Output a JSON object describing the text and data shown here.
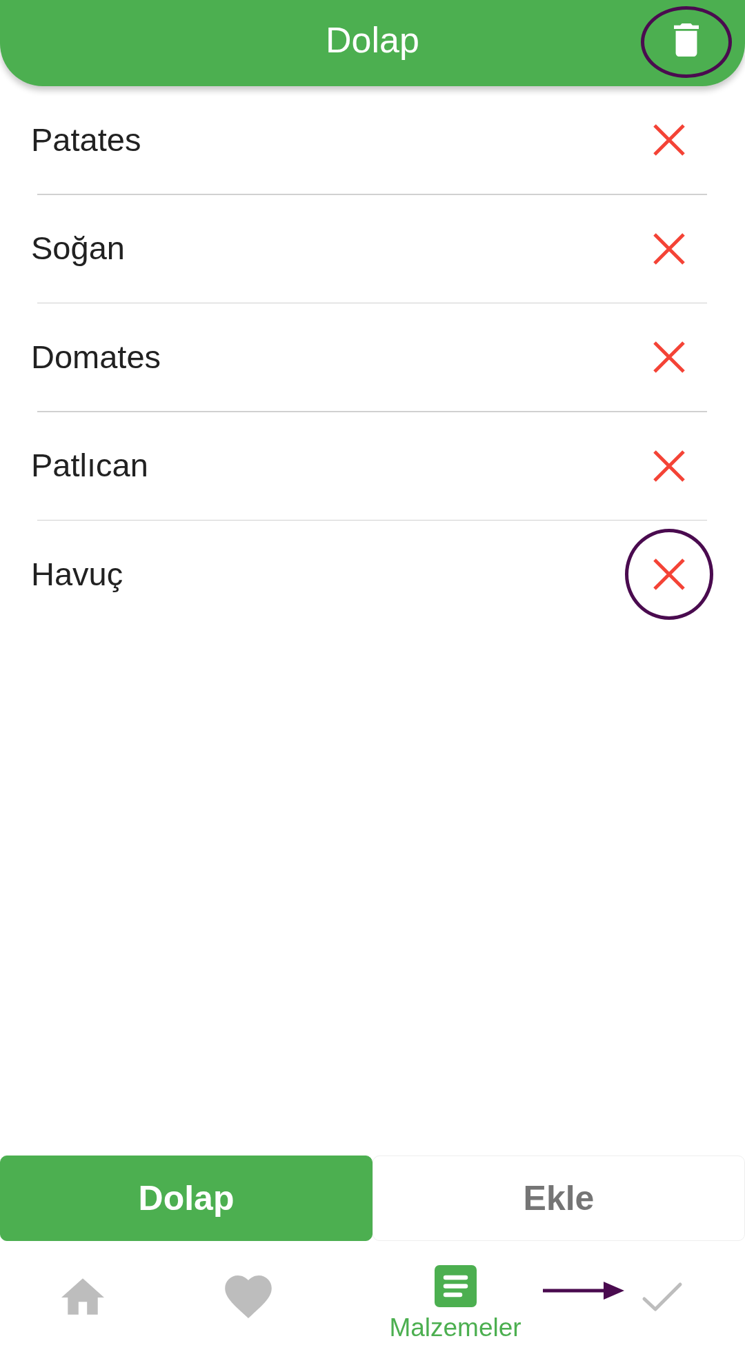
{
  "header": {
    "title": "Dolap",
    "trash_button": {
      "circled": true
    }
  },
  "items": [
    {
      "name": "Patates",
      "circled": false
    },
    {
      "name": "Soğan",
      "circled": false
    },
    {
      "name": "Domates",
      "circled": false
    },
    {
      "name": "Patlıcan",
      "circled": false
    },
    {
      "name": "Havuç",
      "circled": true
    }
  ],
  "tabs": [
    {
      "label": "Dolap",
      "selected": true
    },
    {
      "label": "Ekle",
      "selected": false
    }
  ],
  "bottom_nav": [
    {
      "selected": false,
      "pointed_at": false
    },
    {
      "selected": false,
      "pointed_at": false
    },
    {
      "label": "Malzemeler",
      "selected": true,
      "pointed_at": false
    },
    {
      "selected": false,
      "pointed_at": true
    }
  ]
}
